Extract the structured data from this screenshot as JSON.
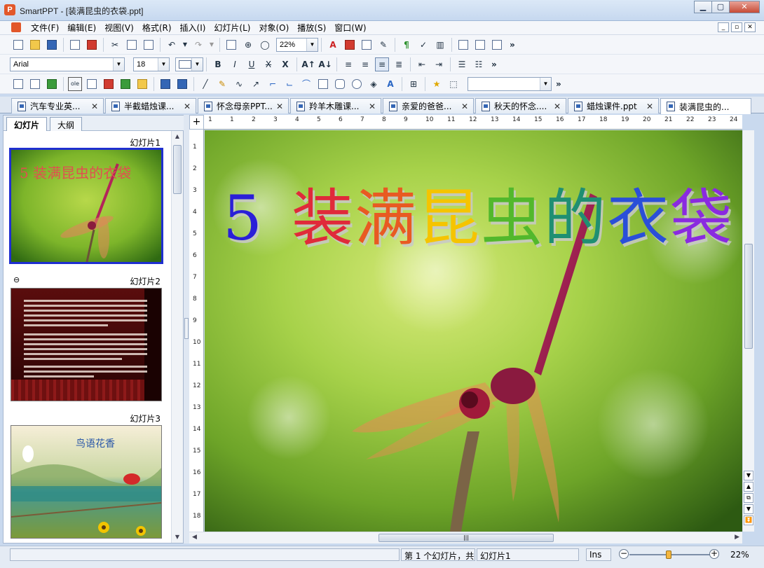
{
  "window": {
    "title": "SmartPPT - [装满昆虫的衣袋.ppt]",
    "app_badge": "P"
  },
  "menu": [
    "文件(F)",
    "编辑(E)",
    "视图(V)",
    "格式(R)",
    "插入(I)",
    "幻灯片(L)",
    "对象(O)",
    "播放(S)",
    "窗口(W)"
  ],
  "toolbar": {
    "zoom": "22%",
    "font_name": "Arial",
    "font_size": "18",
    "more": "»"
  },
  "doc_tabs": [
    {
      "label": "汽车专业英...",
      "active": false
    },
    {
      "label": "半截蜡烛课...",
      "active": false
    },
    {
      "label": "怀念母亲PPT...",
      "active": false
    },
    {
      "label": "羚羊木雕课...",
      "active": false
    },
    {
      "label": "亲爱的爸爸...",
      "active": false
    },
    {
      "label": "秋天的怀念....",
      "active": false
    },
    {
      "label": "蜡烛课件.ppt",
      "active": false
    },
    {
      "label": "装满昆虫的...",
      "active": true
    }
  ],
  "left_pane": {
    "tabs": [
      "幻灯片",
      "大纲"
    ],
    "slides": [
      {
        "label": "幻灯片1",
        "thumb_title": "5  装满昆虫的衣袋"
      },
      {
        "label": "幻灯片2"
      },
      {
        "label": "幻灯片3",
        "thumb_title": "鸟语花香"
      }
    ]
  },
  "hruler_ticks": [
    "1",
    "1",
    "2",
    "3",
    "4",
    "5",
    "6",
    "7",
    "8",
    "9",
    "10",
    "11",
    "12",
    "13",
    "14",
    "15",
    "16",
    "17",
    "18",
    "19",
    "20",
    "21",
    "22",
    "23",
    "24"
  ],
  "vruler_ticks": [
    "1",
    "2",
    "3",
    "4",
    "5",
    "6",
    "7",
    "8",
    "9",
    "10",
    "11",
    "12",
    "13",
    "14",
    "15",
    "16",
    "17",
    "18"
  ],
  "slide": {
    "title_number": "5",
    "title_chars": [
      {
        "ch": "装",
        "color": "#e02a3a"
      },
      {
        "ch": "满",
        "color": "#e85a22"
      },
      {
        "ch": "昆",
        "color": "#f5c400"
      },
      {
        "ch": "虫",
        "color": "#52b82c"
      },
      {
        "ch": "的",
        "color": "#1f8f72"
      },
      {
        "ch": "衣",
        "color": "#2a4fd8"
      },
      {
        "ch": "袋",
        "color": "#8a2ae0"
      }
    ]
  },
  "status": {
    "slide_info": "第 1 个幻灯片，共",
    "slide_name": "幻灯片1",
    "mode": "Ins",
    "zoom": "22%",
    "zoom_fraction": 0.47
  }
}
